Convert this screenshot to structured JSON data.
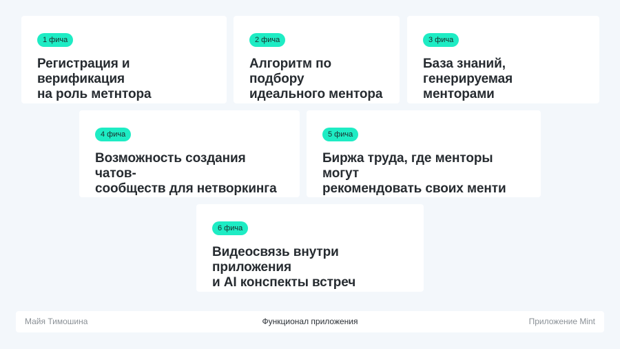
{
  "cards": [
    {
      "badge": "1 фича",
      "title_line1": "Регистрация и верификация",
      "title_line2": "на роль метнтора"
    },
    {
      "badge": "2 фича",
      "title_line1": "Алгоритм по подбору",
      "title_line2": "идеального ментора"
    },
    {
      "badge": "3 фича",
      "title_line1": "База знаний,",
      "title_line2": "генерируемая менторами"
    },
    {
      "badge": "4 фича",
      "title_line1": "Возможность создания чатов-",
      "title_line2": "сообществ для нетворкинга"
    },
    {
      "badge": "5 фича",
      "title_line1": "Биржа труда, где менторы могут",
      "title_line2": "рекомендовать своих менти"
    },
    {
      "badge": "6 фича",
      "title_line1": "Видеосвязь внутри приложения",
      "title_line2": "и AI конспекты встреч"
    }
  ],
  "footer": {
    "author": "Майя Тимошина",
    "section": "Функционал приложения",
    "app": "Приложение Mint"
  }
}
